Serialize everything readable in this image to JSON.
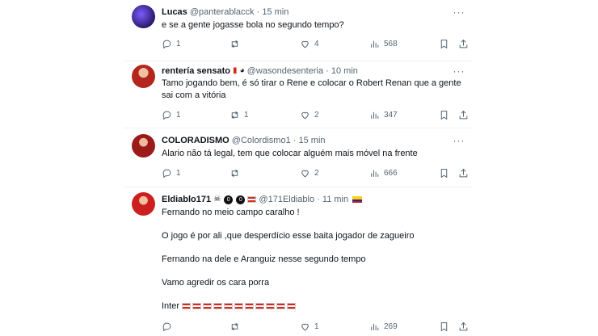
{
  "tweets": [
    {
      "name": "Lucas",
      "handle": "@panterablacck",
      "time": "15 min",
      "lines": [
        "e se a gente jogasse bola no segundo tempo?"
      ],
      "replies": "1",
      "reposts": "",
      "likes": "4",
      "views": "568",
      "avatar_color": "#2a1a6a"
    },
    {
      "name": "rentería sensato",
      "handle": "@wasondesenteria",
      "time": "10 min",
      "lines": [
        "Tamo jogando bem, é só tirar o Rene e colocar o Robert Renan que a gente",
        "sai com a vitória"
      ],
      "replies": "1",
      "reposts": "1",
      "likes": "2",
      "views": "347",
      "avatar_color": "#b3261e"
    },
    {
      "name": "COLORADISMO",
      "handle": "@Colordismo1",
      "time": "15 min",
      "lines": [
        "Alario não tá legal, tem que colocar alguém mais móvel na frente"
      ],
      "replies": "1",
      "reposts": "",
      "likes": "2",
      "views": "666",
      "avatar_color": "#9b1b1b"
    },
    {
      "name": "Eldiablo171",
      "handle": "@171Eldiablo",
      "time": "11 min",
      "badges": [
        "0",
        "0"
      ],
      "lines": [
        "Fernando no meio campo caralho !",
        "",
        "O jogo é por ali ,que desperdício esse baita jogador de zagueiro",
        "",
        "Fernando na dele e Aranguiz nesse segundo tempo",
        "",
        "Vamo agredir os cara porra",
        "",
        "Inter"
      ],
      "replies": "",
      "reposts": "",
      "likes": "1",
      "views": "269",
      "avatar_color": "#cc2020"
    }
  ],
  "separator": "·",
  "more_label": "···"
}
